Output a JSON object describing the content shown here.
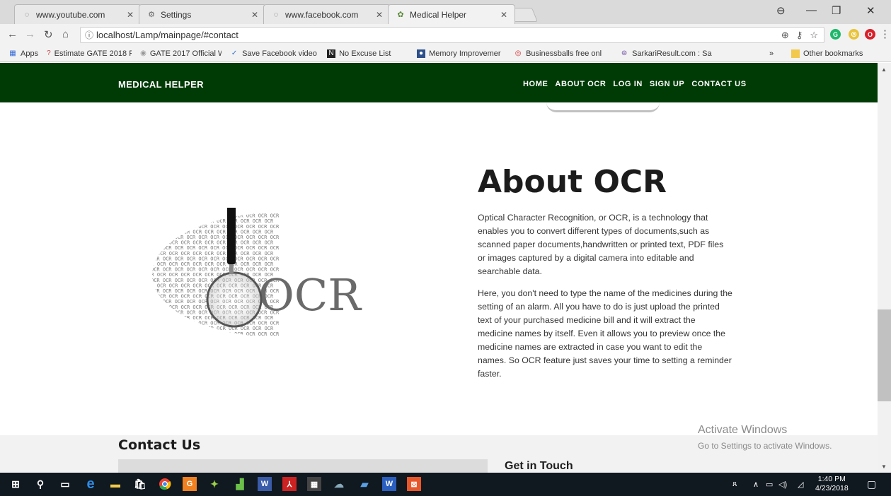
{
  "browser": {
    "tabs": [
      {
        "title": "www.youtube.com",
        "icon": "loading-icon"
      },
      {
        "title": "Settings",
        "icon": "gear-icon"
      },
      {
        "title": "www.facebook.com",
        "icon": "loading-icon"
      },
      {
        "title": "Medical Helper",
        "icon": "site-favicon"
      }
    ],
    "url": "localhost/Lamp/mainpage/#contact",
    "bookmarks": [
      {
        "label": "Apps",
        "icon": "apps-grid-icon"
      },
      {
        "label": "Estimate GATE 2018 F",
        "icon": "bookmark-favicon"
      },
      {
        "label": "GATE 2017 Official W",
        "icon": "bookmark-favicon"
      },
      {
        "label": "Save Facebook video",
        "icon": "bookmark-favicon"
      },
      {
        "label": "No Excuse List",
        "icon": "bookmark-favicon"
      },
      {
        "label": "Memory Improvemer",
        "icon": "bookmark-favicon"
      },
      {
        "label": "Businessballs free onl",
        "icon": "bookmark-favicon"
      },
      {
        "label": "SarkariResult.com : Sa",
        "icon": "bookmark-favicon"
      }
    ],
    "bookmarks_overflow": "»",
    "other_bookmarks": "Other bookmarks"
  },
  "site": {
    "brand": "MEDICAL HELPER",
    "nav": [
      "HOME",
      "ABOUT OCR",
      "LOG IN",
      "SIGN UP",
      "CONTACT US"
    ],
    "about_title": "About OCR",
    "about_p1": "Optical Character Recognition, or OCR, is a technology that enables you to convert different types of documents,such as scanned paper documents,handwritten or printed text, PDF files or images captured by a digital camera into editable and searchable data.",
    "about_p2": "Here, you don't need to type the name of the medicines during the setting of an alarm. All you have to do is just upload the printed text of your purchased medicine bill and it will extract the medicine names by itself. Even it allows you to preview once the medicine names are extracted in case you want to edit the names. So OCR feature just saves your time to setting a reminder faster.",
    "ocr_image_word": "OCR",
    "ocr_image_text_row": "OCR OCR OCR OCR OCR OCR OCR OCR OCR OCR OCR",
    "contact_title": "Contact Us",
    "get_in_touch": "Get in Touch"
  },
  "watermark": {
    "line1": "Activate Windows",
    "line2": "Go to Settings to activate Windows."
  },
  "taskbar": {
    "time": "1:40 PM",
    "date": "4/23/2018"
  },
  "colors": {
    "nav_bg": "#003b06",
    "taskbar_bg": "#101820"
  }
}
